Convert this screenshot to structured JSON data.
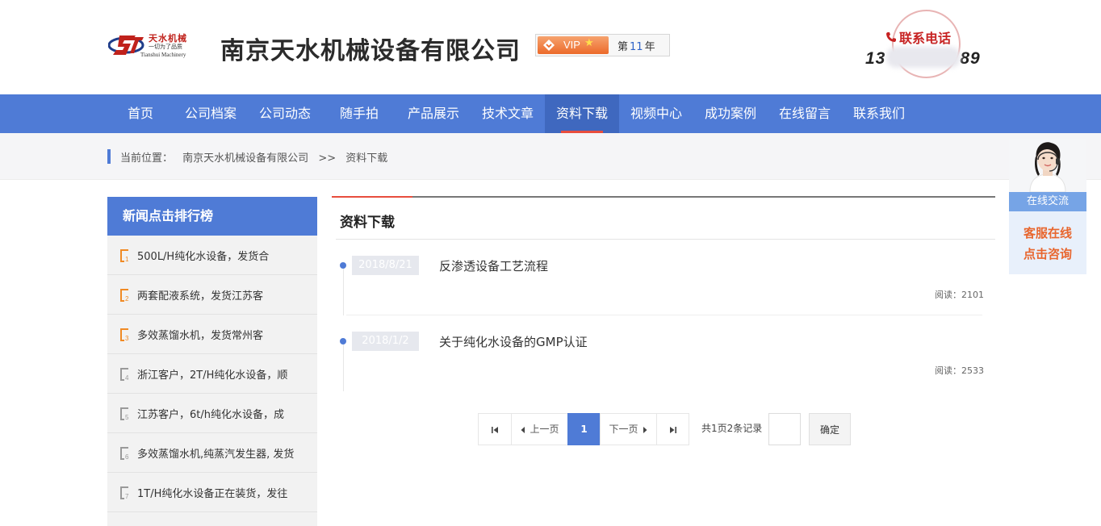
{
  "header": {
    "logo_cn": "天水机械",
    "logo_slogan": "一切为了品质",
    "logo_en": "Tianshui Machinery",
    "company_name": "南京天水机械设备有限公司",
    "vip": {
      "label": "VIP",
      "star": "★",
      "prefix": "第",
      "years": "11",
      "suffix": "年"
    },
    "contact_label": "联系电话",
    "contact_number_start": "13",
    "contact_number_end": "89"
  },
  "nav": {
    "items": [
      {
        "label": "首页"
      },
      {
        "label": "公司档案"
      },
      {
        "label": "公司动态"
      },
      {
        "label": "随手拍"
      },
      {
        "label": "产品展示"
      },
      {
        "label": "技术文章"
      },
      {
        "label": "资料下载"
      },
      {
        "label": "视频中心"
      },
      {
        "label": "成功案例"
      },
      {
        "label": "在线留言"
      },
      {
        "label": "联系我们"
      }
    ],
    "active_index": 6
  },
  "breadcrumb": {
    "prefix": "当前位置：",
    "home": "南京天水机械设备有限公司",
    "sep": ">>",
    "current": "资料下载"
  },
  "sidebar": {
    "title": "新闻点击排行榜",
    "items": [
      {
        "rank": "1",
        "text": "500L/H纯化水设备，发货合"
      },
      {
        "rank": "2",
        "text": "两套配液系统，发货江苏客"
      },
      {
        "rank": "3",
        "text": "多效蒸馏水机，发货常州客"
      },
      {
        "rank": "4",
        "text": "浙江客户，2T/H纯化水设备，顺"
      },
      {
        "rank": "5",
        "text": "江苏客户，6t/h纯化水设备，成"
      },
      {
        "rank": "6",
        "text": "多效蒸馏水机,纯蒸汽发生器, 发货"
      },
      {
        "rank": "7",
        "text": "1T/H纯化水设备正在装货，发往"
      }
    ],
    "colors": {
      "top": "#f08a24",
      "rest": "#9a9a9a"
    }
  },
  "main": {
    "title": "资料下载",
    "articles": [
      {
        "date": "2018/8/21",
        "title": "反渗透设备工艺流程",
        "views_label": "阅读：",
        "views": "2101"
      },
      {
        "date": "2018/1/2",
        "title": "关于纯化水设备的GMP认证",
        "views_label": "阅读：",
        "views": "2533"
      }
    ]
  },
  "pager": {
    "first_icon": "first-page-icon",
    "prev": "上一页",
    "current": "1",
    "next": "下一页",
    "last_icon": "last-page-icon",
    "info": "共1页2条记录",
    "confirm": "确定"
  },
  "float_chat": {
    "label": "在线交流",
    "line1": "客服在线",
    "line2": "点击咨询"
  },
  "colors": {
    "brand_blue": "#4f7bd6",
    "accent_red": "#e84d3d",
    "accent_orange": "#e8662e"
  }
}
